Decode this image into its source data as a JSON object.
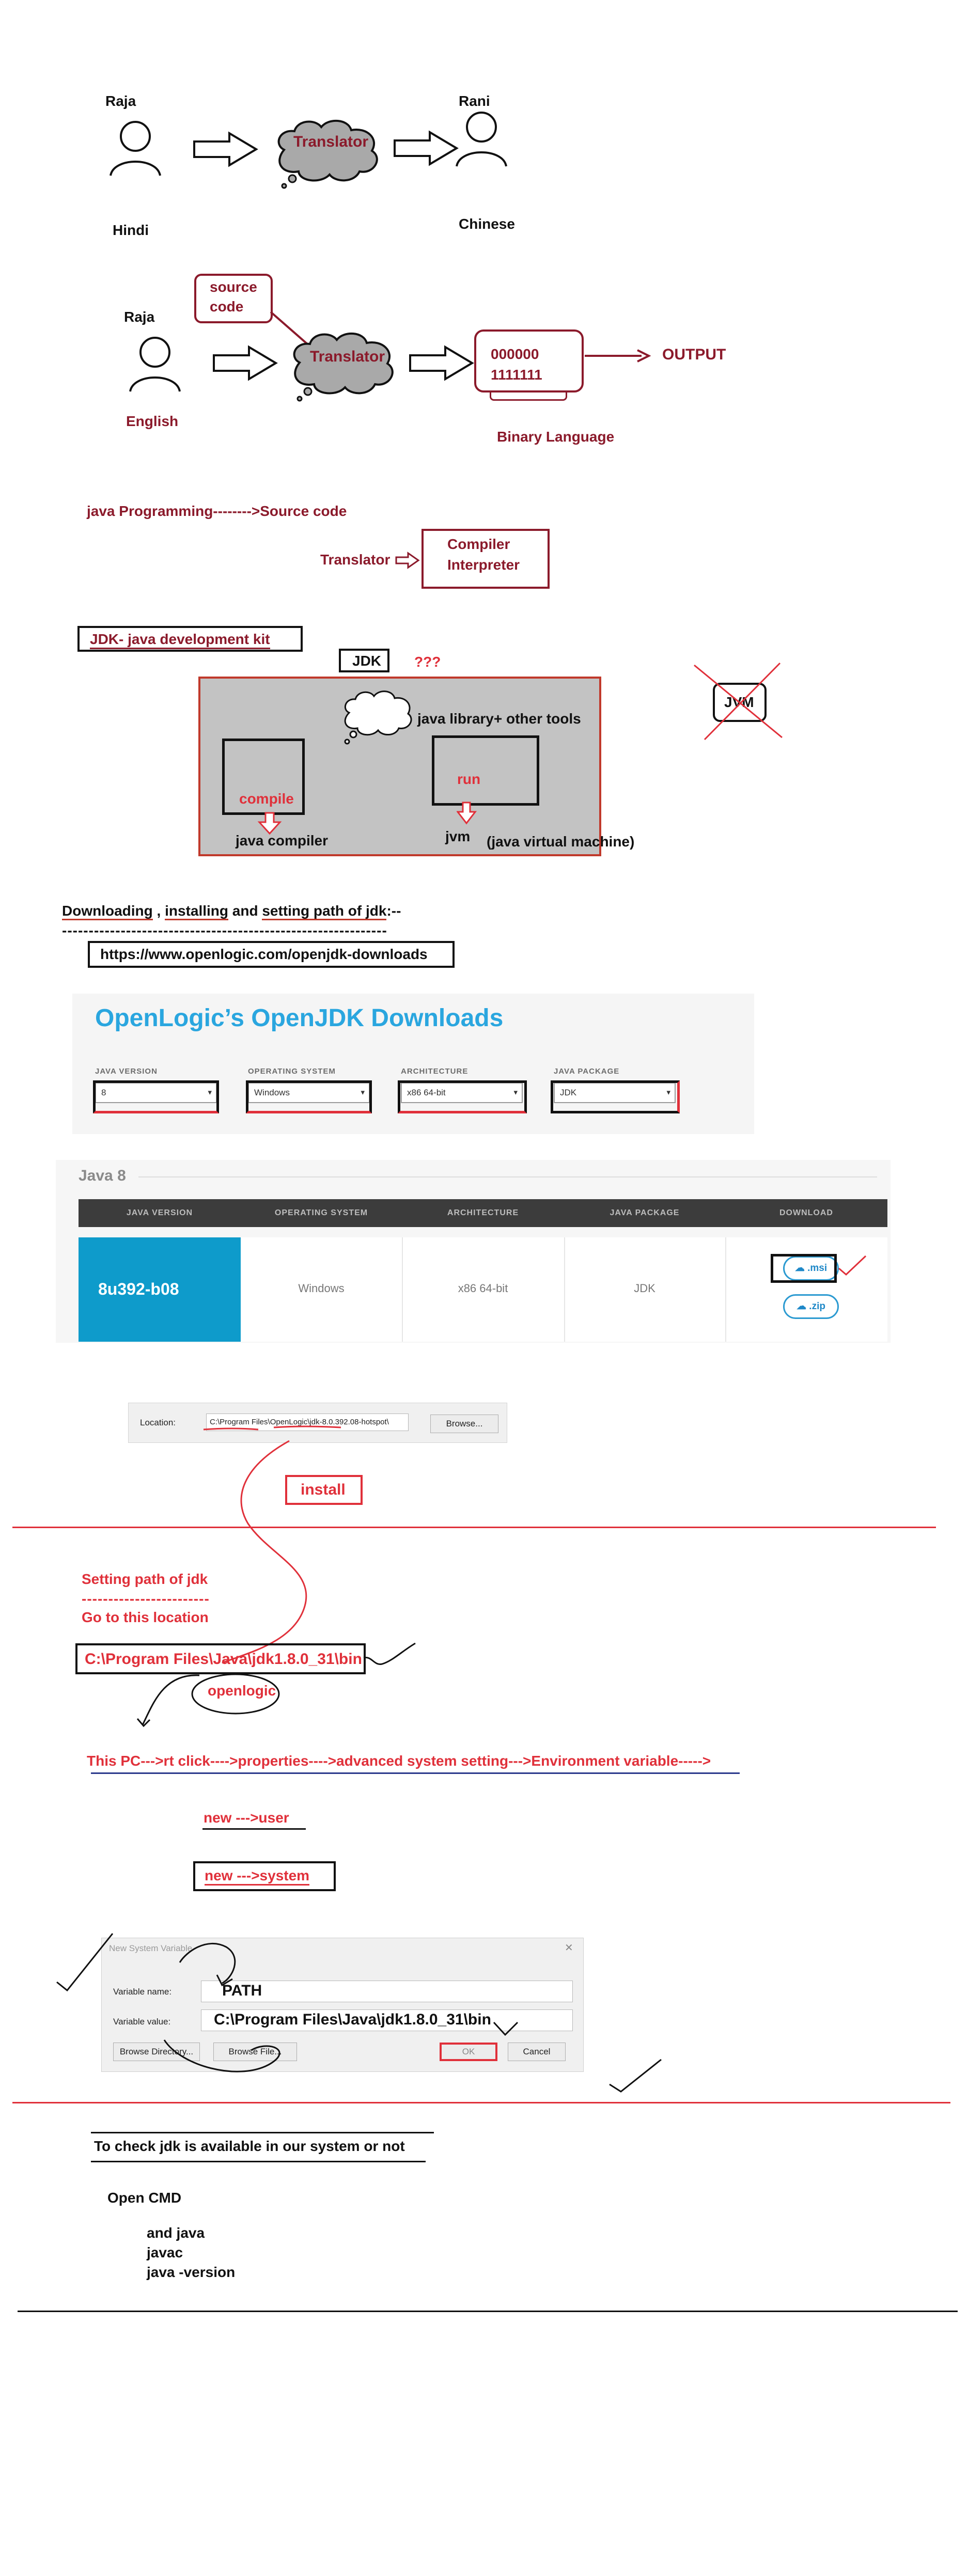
{
  "section1": {
    "person_left": "Raja",
    "person_right": "Rani",
    "translator": "Translator",
    "lang_left": "Hindi",
    "lang_right": "Chinese"
  },
  "section2": {
    "source_code": [
      "source",
      "code"
    ],
    "person": "Raja",
    "translator": "Translator",
    "binary_lines": [
      "000000",
      "1111111"
    ],
    "output": "OUTPUT",
    "lang": "English",
    "binary_language": "Binary Language"
  },
  "section3": {
    "java_line": "java Programming-------->Source code",
    "translator": "Translator",
    "compiler": "Compiler",
    "interpreter": "Interpreter"
  },
  "section4": {
    "jdk_full": "JDK-  java  development kit",
    "jdk": "JDK",
    "question": "???",
    "library": "java library+ other tools",
    "compile": "compile",
    "java_compiler": "java compiler",
    "run": "run",
    "jvm": "jvm",
    "jvm_full": "(java virtual machine)",
    "jvm_crossed": "JVM"
  },
  "section5": {
    "heading_parts": [
      "Downloading",
      " , ",
      "installing",
      " and  ",
      "setting path of jdk",
      ":--"
    ],
    "dashes": "-------------------------------------------------------------",
    "url": "https://www.openlogic.com/openjdk-downloads"
  },
  "openlogic": {
    "title": "OpenLogic’s OpenJDK Downloads",
    "filters": [
      {
        "label": "JAVA VERSION",
        "value": "8"
      },
      {
        "label": "OPERATING SYSTEM",
        "value": "Windows"
      },
      {
        "label": "ARCHITECTURE",
        "value": "x86 64-bit"
      },
      {
        "label": "JAVA PACKAGE",
        "value": "JDK"
      }
    ]
  },
  "java8": {
    "heading": "Java 8",
    "columns": [
      "JAVA VERSION",
      "OPERATING SYSTEM",
      "ARCHITECTURE",
      "JAVA PACKAGE",
      "DOWNLOAD"
    ],
    "row": {
      "version": "8u392-b08",
      "os": "Windows",
      "arch": "x86 64-bit",
      "package": "JDK"
    },
    "buttons": [
      ".msi",
      ".zip"
    ],
    "colors": {
      "header_bg": "#3c3c3c",
      "version_bg": "#0e9bcb",
      "title_blue": "#2aa6df"
    }
  },
  "install": {
    "location_label": "Location:",
    "location_value": "C:\\Program Files\\OpenLogic\\jdk-8.0.392.08-hotspot\\",
    "browse": "Browse...",
    "install_label": "install"
  },
  "path_setting": {
    "setting_path": "Setting path of jdk",
    "dashes": "------------------------",
    "goto": "Go to this location",
    "location": "C:\\Program Files\\Java\\jdk1.8.0_31\\bin",
    "openlogic": "openlogic",
    "this_pc": "This PC--->rt click---->properties---->advanced system setting--->Environment variable----->",
    "new_user": "new --->user",
    "new_system": "new --->system"
  },
  "dialog": {
    "title": "New System Variable",
    "var_name_label": "Variable name:",
    "var_name_value": "PATH",
    "var_value_label": "Variable value:",
    "var_value_value": "C:\\Program Files\\Java\\jdk1.8.0_31\\bin",
    "browse_dir": "Browse Directory...",
    "browse_file": "Browse File...",
    "ok": "OK",
    "cancel": "Cancel"
  },
  "check": {
    "heading": "To check jdk is available in our system or not",
    "open_cmd": "Open CMD",
    "commands": [
      "and java",
      "javac",
      "java  -version"
    ]
  }
}
